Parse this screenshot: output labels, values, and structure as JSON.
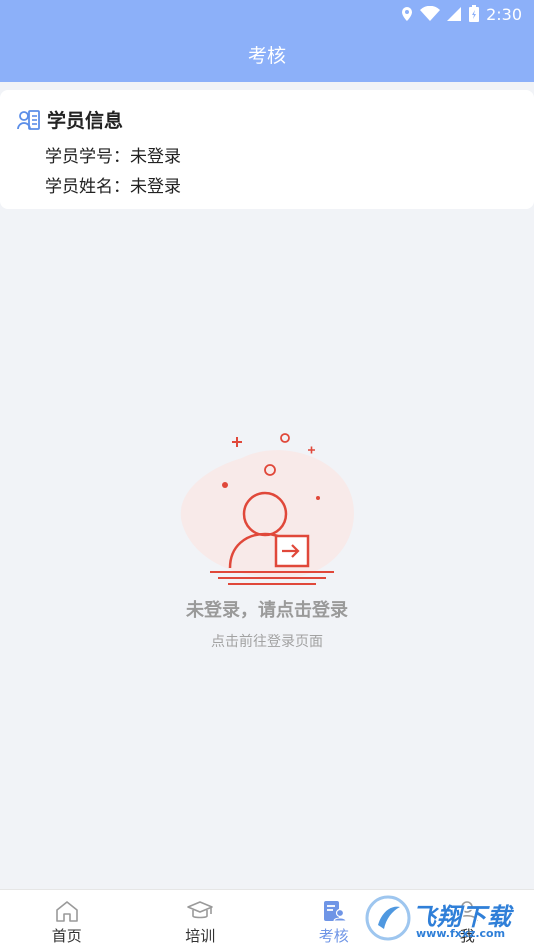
{
  "status_bar": {
    "time": "2:30"
  },
  "header": {
    "title": "考核"
  },
  "student_card": {
    "title": "学员信息",
    "id_label": "学员学号：",
    "id_value": "未登录",
    "name_label": "学员姓名：",
    "name_value": "未登录"
  },
  "empty_state": {
    "title": "未登录，请点击登录",
    "subtitle": "点击前往登录页面"
  },
  "bottom_nav": {
    "items": [
      {
        "label": "首页",
        "icon": "home-icon",
        "active": false
      },
      {
        "label": "培训",
        "icon": "graduation-cap-icon",
        "active": false
      },
      {
        "label": "考核",
        "icon": "exam-icon",
        "active": true
      },
      {
        "label": "我",
        "icon": "profile-icon",
        "active": false
      }
    ]
  },
  "watermark": {
    "text": "飞翔下载",
    "url": "www.fxxz.com"
  },
  "colors": {
    "header": "#8cb0f9",
    "accent": "#6f95e6",
    "illustration": "#e0483a"
  }
}
